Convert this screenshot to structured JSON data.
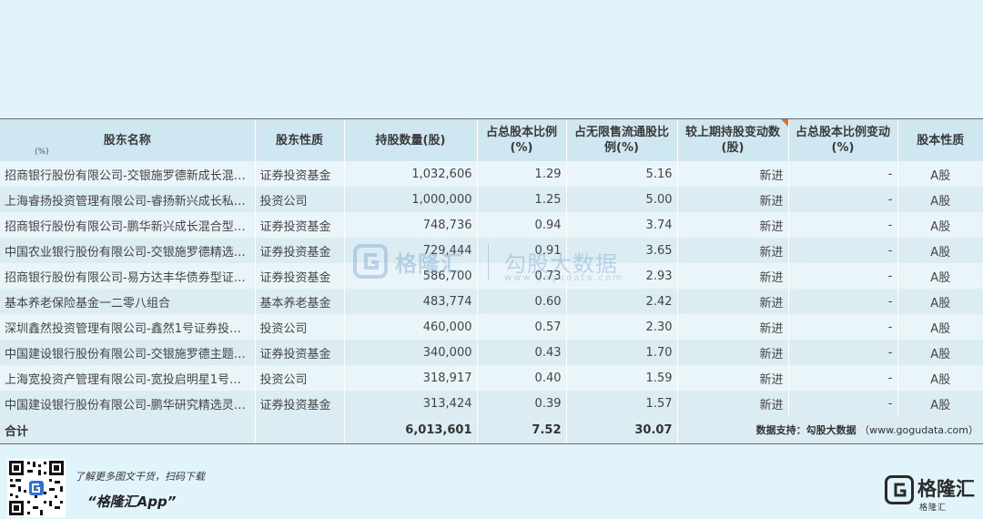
{
  "headers": {
    "name": "股东名称",
    "name_sub": "(%)",
    "type": "股东性质",
    "shares": "持股数量(股)",
    "pct_total": "占总股本比例(%)",
    "pct_float": "占无限售流通股比例(%)",
    "change": "较上期持股变动数(股)",
    "pct_change": "占总股本比例变动(%)",
    "share_type": "股本性质"
  },
  "rows": [
    {
      "name": "招商银行股份有限公司-交银施罗德新成长混…",
      "type": "证券投资基金",
      "shares": "1,032,606",
      "pct_total": "1.29",
      "pct_float": "5.16",
      "change": "新进",
      "pct_change": "-",
      "share_type": "A股"
    },
    {
      "name": "上海睿扬投资管理有限公司-睿扬新兴成长私…",
      "type": "投资公司",
      "shares": "1,000,000",
      "pct_total": "1.25",
      "pct_float": "5.00",
      "change": "新进",
      "pct_change": "-",
      "share_type": "A股"
    },
    {
      "name": "招商银行股份有限公司-鹏华新兴成长混合型…",
      "type": "证券投资基金",
      "shares": "748,736",
      "pct_total": "0.94",
      "pct_float": "3.74",
      "change": "新进",
      "pct_change": "-",
      "share_type": "A股"
    },
    {
      "name": "中国农业银行股份有限公司-交银施罗德精选…",
      "type": "证券投资基金",
      "shares": "729,444",
      "pct_total": "0.91",
      "pct_float": "3.65",
      "change": "新进",
      "pct_change": "-",
      "share_type": "A股"
    },
    {
      "name": "招商银行股份有限公司-易方达丰华债券型证…",
      "type": "证券投资基金",
      "shares": "586,700",
      "pct_total": "0.73",
      "pct_float": "2.93",
      "change": "新进",
      "pct_change": "-",
      "share_type": "A股"
    },
    {
      "name": "基本养老保险基金一二零八组合",
      "type": "基本养老基金",
      "shares": "483,774",
      "pct_total": "0.60",
      "pct_float": "2.42",
      "change": "新进",
      "pct_change": "-",
      "share_type": "A股"
    },
    {
      "name": "深圳鑫然投资管理有限公司-鑫然1号证券投…",
      "type": "投资公司",
      "shares": "460,000",
      "pct_total": "0.57",
      "pct_float": "2.30",
      "change": "新进",
      "pct_change": "-",
      "share_type": "A股"
    },
    {
      "name": "中国建设银行股份有限公司-交银施罗德主题…",
      "type": "证券投资基金",
      "shares": "340,000",
      "pct_total": "0.43",
      "pct_float": "1.70",
      "change": "新进",
      "pct_change": "-",
      "share_type": "A股"
    },
    {
      "name": "上海宽投资产管理有限公司-宽投启明星1号…",
      "type": "投资公司",
      "shares": "318,917",
      "pct_total": "0.40",
      "pct_float": "1.59",
      "change": "新进",
      "pct_change": "-",
      "share_type": "A股"
    },
    {
      "name": "中国建设银行股份有限公司-鹏华研究精选灵…",
      "type": "证券投资基金",
      "shares": "313,424",
      "pct_total": "0.39",
      "pct_float": "1.57",
      "change": "新进",
      "pct_change": "-",
      "share_type": "A股"
    }
  ],
  "total": {
    "label": "合计",
    "shares": "6,013,601",
    "pct_total": "7.52",
    "pct_float": "30.07",
    "credit_label": "数据支持：",
    "credit_source": "勾股大数据",
    "credit_url": "（www.gogudata.com）"
  },
  "watermark": {
    "name": "格隆汇",
    "cn": "勾股大数据",
    "url": "www.gogudata.com"
  },
  "footer": {
    "promo_line": "了解更多图文干货，扫码下载",
    "app_name": "“格隆汇App”",
    "brand_name": "格隆汇",
    "brand_sub": "格隆汇"
  },
  "colors": {
    "page_bg": "#e1f4fb",
    "header_bg": "#cfe7f1",
    "row_light": "#eaf5fa",
    "row_dark": "#dcecf3",
    "corner_marker": "#e86a2a",
    "logo_blue": "#2f6fd8"
  },
  "icons": {
    "watermark_logo": "gelonghui-logo-icon",
    "brand_logo": "gelonghui-logo-icon",
    "qr": "qr-code-icon"
  }
}
